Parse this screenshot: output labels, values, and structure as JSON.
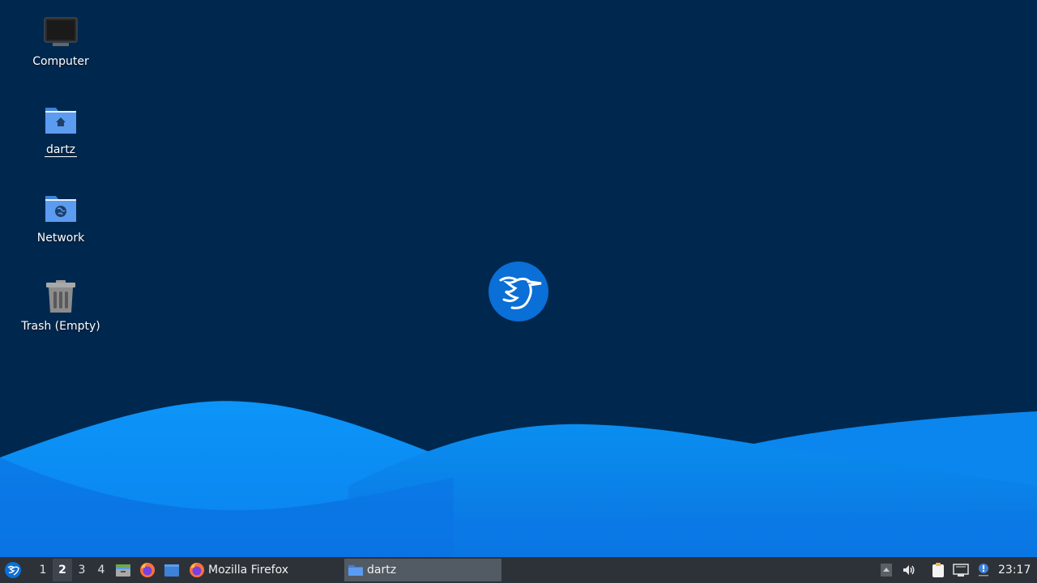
{
  "desktop": {
    "background_color": "#00284f",
    "icons": [
      {
        "label": "Computer",
        "icon": "computer-icon"
      },
      {
        "label": "dartz",
        "icon": "home-folder-icon"
      },
      {
        "label": "Network",
        "icon": "network-folder-icon"
      },
      {
        "label": "Trash (Empty)",
        "icon": "trash-icon"
      }
    ],
    "center_logo": "hummingbird-logo-icon"
  },
  "taskbar": {
    "background_color": "#2d3238",
    "menu_icon": "app-menu-icon",
    "workspaces": [
      "1",
      "2",
      "3",
      "4"
    ],
    "active_workspace": "2",
    "launchers": [
      {
        "icon": "file-manager-icon"
      },
      {
        "icon": "firefox-icon"
      },
      {
        "icon": "show-desktop-icon"
      }
    ],
    "tasks": [
      {
        "label": "Mozilla Firefox",
        "icon": "firefox-icon",
        "active": false
      },
      {
        "label": "dartz",
        "icon": "folder-icon",
        "active": true
      }
    ],
    "tray": [
      {
        "icon": "tray-expand-icon"
      },
      {
        "icon": "volume-icon"
      },
      {
        "icon": "clipboard-icon"
      },
      {
        "icon": "network-status-icon"
      },
      {
        "icon": "notification-icon"
      }
    ],
    "clock": "23:17"
  }
}
